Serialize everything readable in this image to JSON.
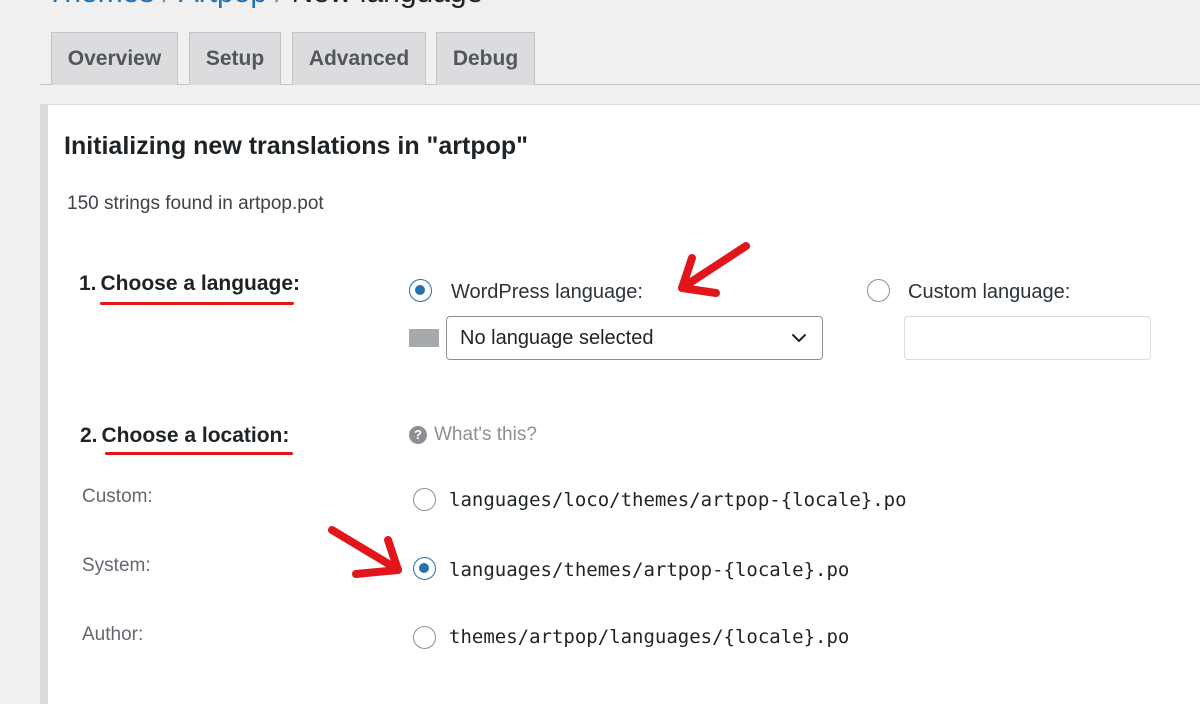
{
  "breadcrumb": {
    "items": [
      "Themes",
      "Artpop"
    ],
    "current": "New language",
    "separator": "/"
  },
  "tabs": [
    {
      "label": "Overview"
    },
    {
      "label": "Setup"
    },
    {
      "label": "Advanced"
    },
    {
      "label": "Debug"
    }
  ],
  "heading": "Initializing new translations in \"artpop\"",
  "strings_found": "150 strings found in artpop.pot",
  "step1": {
    "number": "1.",
    "label": "Choose a language:",
    "wordpress_option": {
      "label": "WordPress language:",
      "checked": true
    },
    "custom_option": {
      "label": "Custom language:",
      "checked": false
    },
    "select_value": "No language selected",
    "custom_input_value": ""
  },
  "step2": {
    "number": "2.",
    "label": "Choose a location:",
    "help_text": "What's this?",
    "locations": [
      {
        "label": "Custom:",
        "path": "languages/loco/themes/artpop-{locale}.po",
        "checked": false
      },
      {
        "label": "System:",
        "path": "languages/themes/artpop-{locale}.po",
        "checked": true
      },
      {
        "label": "Author:",
        "path": "themes/artpop/languages/{locale}.po",
        "checked": false
      }
    ]
  },
  "colors": {
    "accent": "#2271b1",
    "annotation_red": "#e0161a"
  }
}
